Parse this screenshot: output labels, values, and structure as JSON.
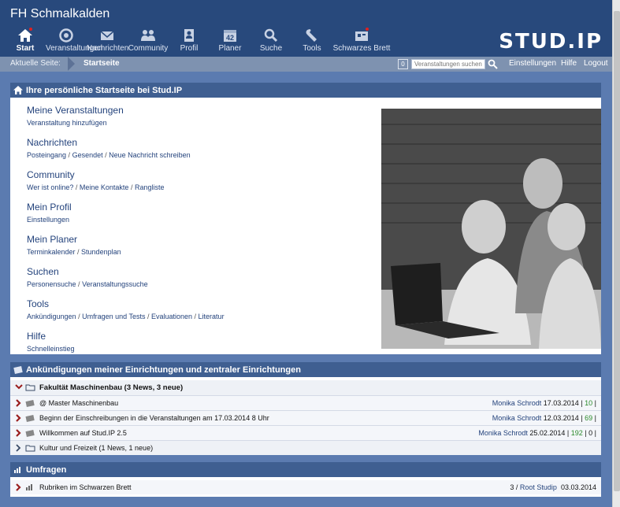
{
  "header": {
    "site_title": "FH Schmalkalden",
    "logo": "STUD.IP",
    "nav": [
      {
        "label": "Start",
        "icon": "home-icon",
        "active": true
      },
      {
        "label": "Veranstaltungen",
        "icon": "courses-icon"
      },
      {
        "label": "Nachrichten",
        "icon": "mail-icon"
      },
      {
        "label": "Community",
        "icon": "community-icon"
      },
      {
        "label": "Profil",
        "icon": "profile-icon"
      },
      {
        "label": "Planer",
        "icon": "calendar-icon",
        "calendar_day": "42"
      },
      {
        "label": "Suche",
        "icon": "search-icon"
      },
      {
        "label": "Tools",
        "icon": "wrench-icon"
      },
      {
        "label": "Schwarzes Brett",
        "icon": "board-icon"
      }
    ]
  },
  "breadcrumb": {
    "label": "Aktuelle Seite:",
    "current": "Startseite",
    "count": "0",
    "search_placeholder": "Veranstaltungen suchen",
    "links": [
      "Einstellungen",
      "Hilfe",
      "Logout"
    ]
  },
  "start_panel": {
    "title": "Ihre persönliche Startseite bei Stud.IP",
    "groups": [
      {
        "title": "Meine Veranstaltungen",
        "links": [
          "Veranstaltung hinzufügen"
        ]
      },
      {
        "title": "Nachrichten",
        "links": [
          "Posteingang",
          "Gesendet",
          "Neue Nachricht schreiben"
        ]
      },
      {
        "title": "Community",
        "links": [
          "Wer ist online?",
          "Meine Kontakte",
          "Rangliste"
        ]
      },
      {
        "title": "Mein Profil",
        "links": [
          "Einstellungen"
        ]
      },
      {
        "title": "Mein Planer",
        "links": [
          "Terminkalender",
          "Stundenplan"
        ]
      },
      {
        "title": "Suchen",
        "links": [
          "Personensuche",
          "Veranstaltungssuche"
        ]
      },
      {
        "title": "Tools",
        "links": [
          "Ankündigungen",
          "Umfragen und Tests",
          "Evaluationen",
          "Literatur"
        ]
      },
      {
        "title": "Hilfe",
        "links": [
          "Schnelleinstieg"
        ]
      }
    ]
  },
  "news_panel": {
    "title": "Ankündigungen meiner Einrichtungen und zentraler Einrichtungen",
    "group1": "Fakultät Maschinenbau (3 News, 3 neue)",
    "items": [
      {
        "title": "@ Master Maschinenbau",
        "author": "Monika Schrodt",
        "date": "17.03.2014",
        "views": "10"
      },
      {
        "title": "Beginn der Einschreibungen in die Veranstaltungen am 17.03.2014 8 Uhr",
        "author": "Monika Schrodt",
        "date": "12.03.2014",
        "views": "69"
      },
      {
        "title": "Willkommen auf Stud.IP 2.5",
        "author": "Monika Schrodt",
        "date": "25.02.2014",
        "views": "192",
        "extra": "0"
      }
    ],
    "group2": "Kultur und Freizeit (1 News, 1 neue)"
  },
  "survey_panel": {
    "title": "Umfragen",
    "item": {
      "title": "Rubriken im Schwarzen Brett",
      "count": "3",
      "author": "Root Studip",
      "date": "03.03.2014"
    }
  },
  "colors": {
    "accent": "#24437c",
    "header": "#28497c",
    "views": "#2a8a2a"
  }
}
